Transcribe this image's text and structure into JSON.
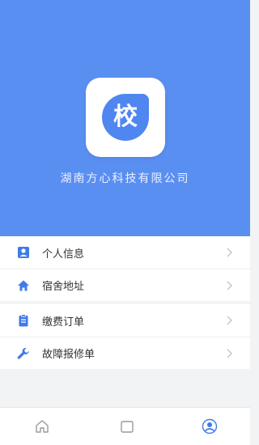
{
  "header": {
    "logo_char": "校",
    "company_name": "湖南方心科技有限公司"
  },
  "menu": {
    "group1": [
      {
        "label": "个人信息",
        "icon": "person-card-icon"
      },
      {
        "label": "宿舍地址",
        "icon": "home-icon"
      }
    ],
    "group2": [
      {
        "label": "缴费订单",
        "icon": "clipboard-icon"
      },
      {
        "label": "故障报修单",
        "icon": "wrench-icon"
      }
    ]
  },
  "tabbar": {
    "tabs": [
      {
        "icon": "home-outline-icon"
      },
      {
        "icon": "square-icon"
      },
      {
        "icon": "user-icon",
        "active": true
      }
    ]
  },
  "colors": {
    "hero": "#5a8ff2",
    "accent": "#3f7be8"
  }
}
